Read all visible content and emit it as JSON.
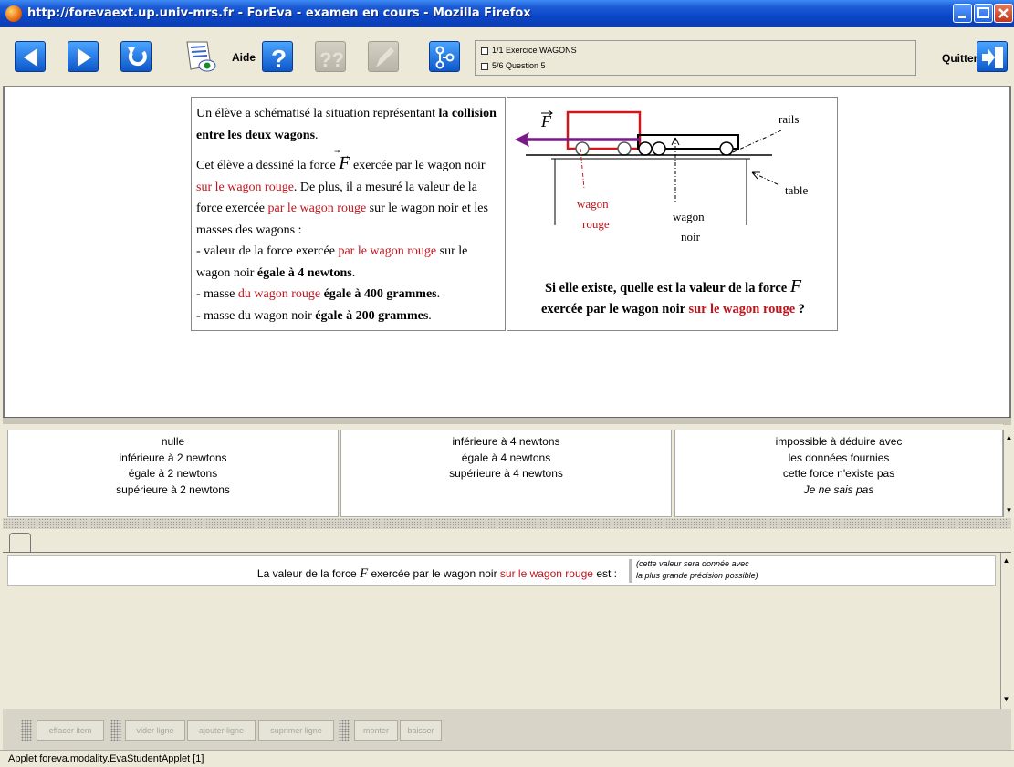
{
  "window": {
    "title": "http://forevaext.up.univ-mrs.fr - ForEva - examen en cours - Mozilla Firefox"
  },
  "toolbar": {
    "aide_label": "Aide",
    "quitter_label": "Quitter",
    "exercise_line": "1/1  Exercice WAGONS",
    "question_line": "5/6  Question 5"
  },
  "statement": {
    "p1_a": "Un élève a schématisé la situation représentant ",
    "p1_b": "la collision entre les deux wagons",
    "p1_c": ".",
    "p2_a": "Cet élève a dessiné la force ",
    "p2_force": "F",
    "p2_b": " exercée par le wagon noir ",
    "p2_c": "sur le wagon rouge",
    "p2_d": ". De plus, il a mesuré la valeur de la force exercée ",
    "p2_e": "par le wagon rouge",
    "p2_f": " sur le wagon noir et les masses des wagons :",
    "l1_a": "- valeur de la force exercée ",
    "l1_b": "par le wagon rouge",
    "l1_c": " sur le wagon noir ",
    "l1_d": "égale à 4 newtons",
    "l1_e": ".",
    "l2_a": "- masse ",
    "l2_b": "du wagon rouge",
    "l2_c": " ",
    "l2_d": "égale à 400 grammes",
    "l2_e": ".",
    "l3_a": "- masse du wagon noir ",
    "l3_b": "égale à 200 grammes",
    "l3_c": "."
  },
  "diagram": {
    "force_label": "F",
    "rails_label": "rails",
    "table_label": "table",
    "wagon_rouge_l1": "wagon",
    "wagon_rouge_l2": "rouge",
    "wagon_noir_l1": "wagon",
    "wagon_noir_l2": "noir"
  },
  "question": {
    "q_a": "Si elle existe, quelle est la valeur de la force ",
    "q_force": "F",
    "q_b": "exercée par le wagon noir ",
    "q_c": "sur le wagon rouge",
    "q_d": " ?"
  },
  "choices": {
    "col1": [
      "nulle",
      "inférieure à 2 newtons",
      "égale à 2 newtons",
      "supérieure à 2 newtons"
    ],
    "col2": [
      "inférieure à 4 newtons",
      "égale à 4 newtons",
      "supérieure à 4 newtons"
    ],
    "col3": [
      "impossible à déduire avec",
      "les données fournies",
      "cette force n'existe pas",
      "Je ne sais pas"
    ]
  },
  "answer": {
    "text_a": "La valeur de la force ",
    "force": "F",
    "text_b": " exercée par le wagon noir ",
    "text_c": "sur le wagon rouge",
    "text_d": " est :",
    "hint_l1": "(cette valeur sera donnée avec",
    "hint_l2": "la plus grande précision possible) "
  },
  "bottom_buttons": {
    "effacer": "effacer item",
    "vider": "vider ligne",
    "ajouter": "ajouter ligne",
    "supprimer": "suprimer ligne",
    "monter": "monter",
    "baisser": "baisser"
  },
  "status": {
    "text": "Applet foreva.modality.EvaStudentApplet [1]"
  },
  "colors": {
    "red_text": "#c0141c",
    "force_arrow": "#7a1a8a",
    "wagon_rouge": "#d0181c"
  }
}
